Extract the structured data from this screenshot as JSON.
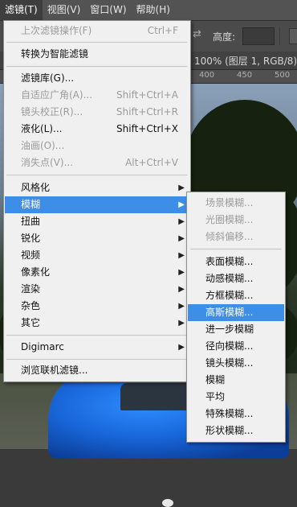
{
  "menubar": {
    "filter": "滤镜(T)",
    "view": "视图(V)",
    "window": "窗口(W)",
    "help": "帮助(H)"
  },
  "options": {
    "height_label": "高度:"
  },
  "document": {
    "tab_title": "100% (图层 1, RGB/8) *",
    "ruler_numbers": [
      "400",
      "450",
      "500"
    ]
  },
  "filter_menu": {
    "last_filter": {
      "label": "上次滤镜操作(F)",
      "shortcut": "Ctrl+F"
    },
    "convert_smart": "转换为智能滤镜",
    "gallery": "滤镜库(G)...",
    "adaptive_wide": {
      "label": "自适应广角(A)...",
      "shortcut": "Shift+Ctrl+A"
    },
    "lens_correction": {
      "label": "镜头校正(R)...",
      "shortcut": "Shift+Ctrl+R"
    },
    "liquify": {
      "label": "液化(L)...",
      "shortcut": "Shift+Ctrl+X"
    },
    "oil_paint": "油画(O)...",
    "vanishing_point": {
      "label": "消失点(V)...",
      "shortcut": "Alt+Ctrl+V"
    },
    "stylize": "风格化",
    "blur": "模糊",
    "distort": "扭曲",
    "sharpen": "锐化",
    "video": "视频",
    "pixelate": "像素化",
    "render": "渲染",
    "noise": "杂色",
    "other": "其它",
    "digimarc": "Digimarc",
    "browse_online": "浏览联机滤镜..."
  },
  "blur_submenu": {
    "field_blur": "场景模糊...",
    "iris_blur": "光圈模糊...",
    "tilt_shift": "倾斜偏移...",
    "surface_blur": "表面模糊...",
    "motion_blur": "动感模糊...",
    "box_blur": "方框模糊...",
    "gaussian_blur": "高斯模糊...",
    "blur_more": "进一步模糊",
    "radial_blur": "径向模糊...",
    "lens_blur": "镜头模糊...",
    "blur": "模糊",
    "average": "平均",
    "smart_blur": "特殊模糊...",
    "shape_blur": "形状模糊..."
  },
  "colors": {
    "highlight": "#3d8ee6",
    "menu_bg": "#f0f0f0"
  }
}
